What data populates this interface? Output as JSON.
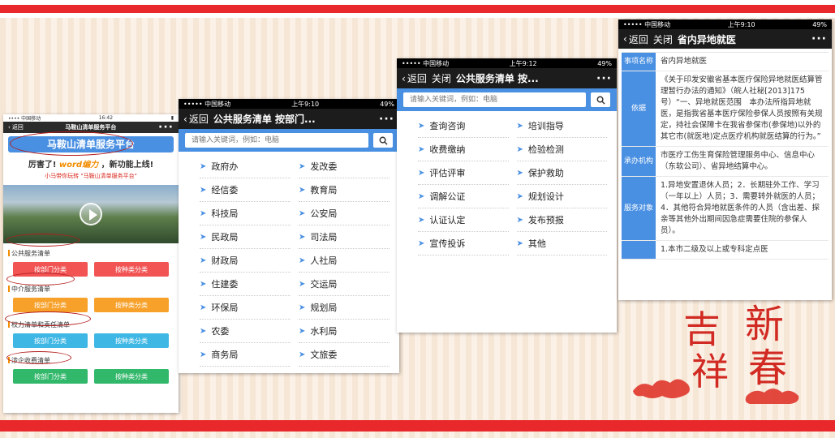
{
  "phone1": {
    "carrier": "•••• 中国移动",
    "time": "16:42",
    "nav_title": "马鞍山清单服务平台",
    "back_label": "返回",
    "banner": "马鞍山清单服务平台",
    "promo_a": "厉害了! ",
    "promo_word": "word编力",
    "promo_b": " ，新功能上线!",
    "promo_note": "小马带你玩转 \"马鞍山清单服务平台\"",
    "sections": [
      {
        "title": "公共服务清单",
        "btn1": "按部门分类",
        "btn2": "按种类分类",
        "color": "red"
      },
      {
        "title": "中介服务清单",
        "btn1": "按部门分类",
        "btn2": "按种类分类",
        "color": "orange"
      },
      {
        "title": "权力清单和责任清单",
        "btn1": "按部门分类",
        "btn2": "按种类分类",
        "color": "blue"
      },
      {
        "title": "涉企收费清单",
        "btn1": "按部门分类",
        "btn2": "按种类分类",
        "color": "green"
      }
    ]
  },
  "phone2": {
    "carrier": "••••• 中国移动",
    "time": "上午9:10",
    "battery": "49%",
    "back_label": "返回",
    "title": "公共服务清单 按部门...",
    "search_placeholder": "请输入关键词，例如：电脑",
    "items": [
      "政府办",
      "发改委",
      "经信委",
      "教育局",
      "科技局",
      "公安局",
      "民政局",
      "司法局",
      "财政局",
      "人社局",
      "住建委",
      "交运局",
      "环保局",
      "规划局",
      "农委",
      "水利局",
      "商务局",
      "文旅委"
    ]
  },
  "phone3": {
    "carrier": "••••• 中国移动",
    "time": "上午9:12",
    "battery": "49%",
    "back_label": "返回",
    "close_label": "关闭",
    "title": "公共服务清单 按...",
    "search_placeholder": "请输入关键词，例如：电脑",
    "items": [
      "查询咨询",
      "培训指导",
      "收费缴纳",
      "检验检测",
      "评估评审",
      "保护救助",
      "调解公证",
      "规划设计",
      "认证认定",
      "发布预报",
      "宣传投诉",
      "其他"
    ]
  },
  "phone4": {
    "carrier": "••••• 中国移动",
    "time": "上午9:10",
    "battery": "49%",
    "back_label": "返回",
    "close_label": "关闭",
    "title": "省内异地就医",
    "rows": [
      {
        "label": "事项名称",
        "value": "省内异地就医"
      },
      {
        "label": "依据",
        "value": "《关于印发安徽省基本医疗保险异地就医结算管理暂行办法的通知》（皖人社秘[2013]175号）“一、异地就医范围　本办法所指异地就医，是指我省基本医疗保险参保人员按照有关规定，持社会保障卡在我省参保市(参保地)以外的其它市(就医地)定点医疗机构就医结算的行为。”"
      },
      {
        "label": "承办机构",
        "value": "市医疗工伤生育保险管理服务中心、信息中心（东软公司）、省异地结算中心。"
      },
      {
        "label": "服务对象",
        "value": "1.异地安置退休人员；2．长期驻外工作、学习（一年以上）人员；3．需要转外就医的人员；4．其他符合异地就医条件的人员（含出差、探亲等其他外出期间因急症需要住院的参保人员）。"
      },
      {
        "label": "",
        "value": "1.本市二级及以上或专科定点医"
      }
    ]
  },
  "decoration": {
    "chars": [
      "吉",
      "祥",
      "新",
      "春"
    ]
  }
}
